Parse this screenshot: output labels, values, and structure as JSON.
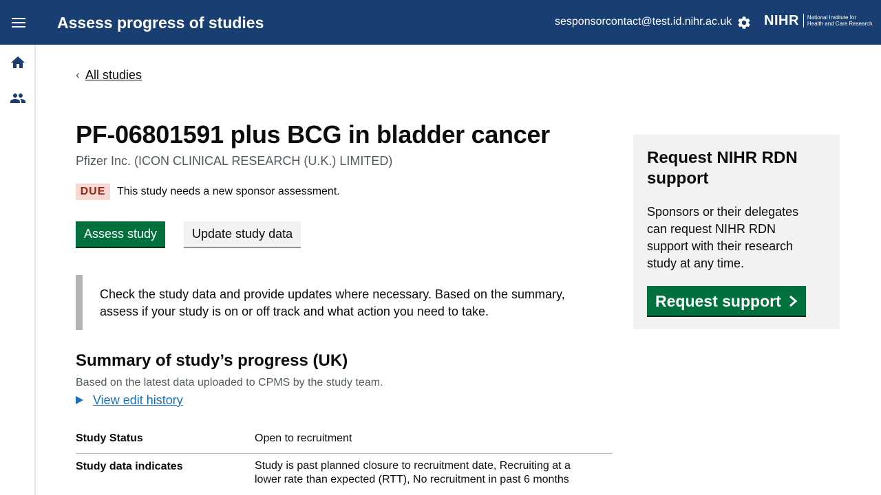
{
  "header": {
    "menu_icon": "menu-icon",
    "title": "Assess progress of studies",
    "user_email": "sesponsorcontact@test.id.nihr.ac.uk",
    "settings_icon": "gear-icon",
    "logo": {
      "main": "NIHR",
      "sub_line1": "National Institute for",
      "sub_line2": "Health and Care Research"
    },
    "background_color": "#193e72"
  },
  "sidebar": {
    "items": [
      {
        "icon": "home-icon"
      },
      {
        "icon": "people-icon"
      }
    ]
  },
  "main": {
    "back_link": "All studies",
    "title": "PF-06801591 plus BCG in bladder cancer",
    "sponsor": "Pfizer Inc. (ICON CLINICAL RESEARCH (U.K.) LIMITED)",
    "status_tag": "DUE",
    "status_text": "This study needs a new sponsor assessment.",
    "buttons": {
      "assess": "Assess study",
      "update": "Update study data"
    },
    "inset_text": "Check the study data and provide updates where necessary. Based on the summary, assess if your study is on or off track and what action you need to take.",
    "summary": {
      "heading": "Summary of study’s progress (UK)",
      "subtext": "Based on the latest data uploaded to CPMS by the study team.",
      "details_link": "View edit history",
      "rows": [
        {
          "key": "Study Status",
          "value": "Open to recruitment"
        },
        {
          "key": "Study data indicates",
          "value": "Study is past planned closure to recruitment date, Recruiting at a lower rate than expected (RTT), No recruitment in past 6 months"
        }
      ]
    }
  },
  "support_panel": {
    "heading": "Request NIHR RDN support",
    "text": "Sponsors or their delegates can request NIHR RDN support with their research study at any time.",
    "button": "Request support"
  },
  "colors": {
    "primary_button": "#00703c",
    "tag_background": "#f6d7d2",
    "tag_text": "#942514",
    "link": "#1d70b8"
  }
}
